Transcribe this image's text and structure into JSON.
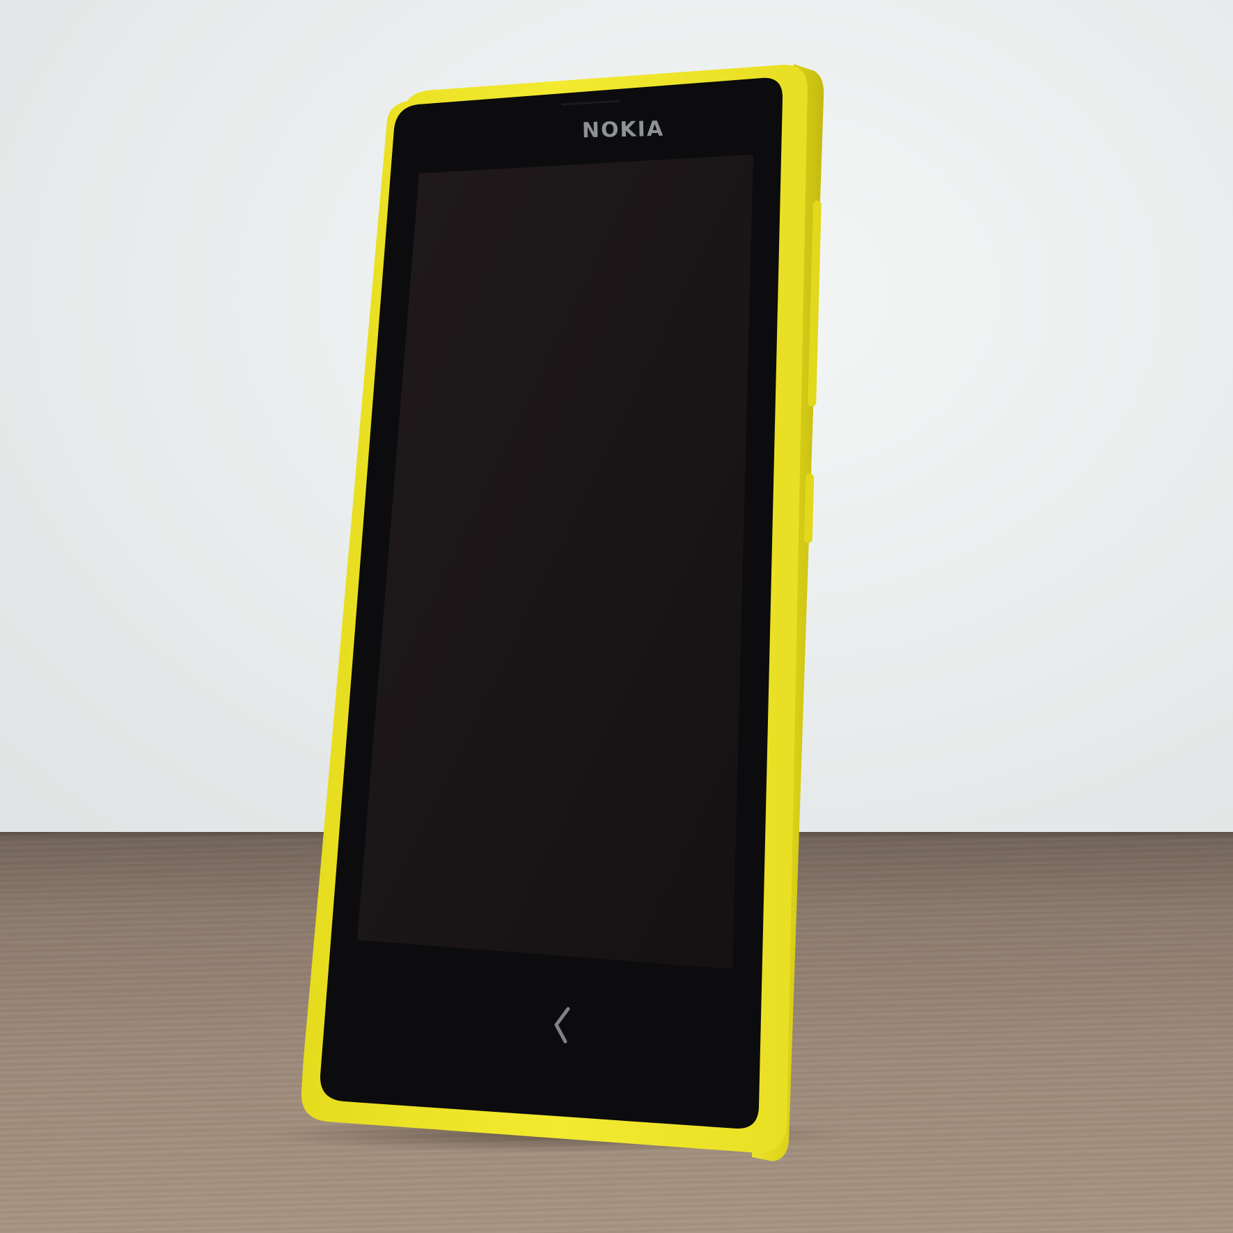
{
  "scene": {
    "wall_color": "#eaeded",
    "table_color": "#9a8878"
  },
  "phone": {
    "brand_text": "NOKIA",
    "body_color": "#f0e62a",
    "screen_color": "#1a1416",
    "bezel_color": "#0b0a0c",
    "back_button_icon": "chevron-left-icon"
  }
}
